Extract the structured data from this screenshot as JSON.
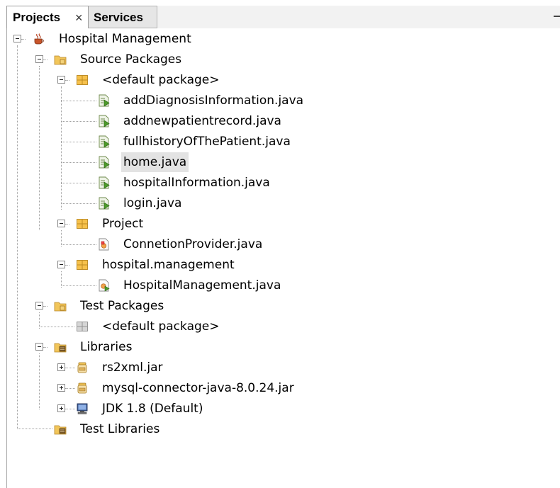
{
  "tabs": {
    "projects_label": "Projects",
    "close_glyph": "×",
    "services_label": "Services"
  },
  "tree": {
    "project_name": "Hospital Management",
    "source_packages": "Source Packages",
    "default_package": "<default package>",
    "files_default": [
      "addDiagnosisInformation.java",
      "addnewpatientrecord.java",
      "fullhistoryOfThePatient.java",
      "home.java",
      "hospitalInformation.java",
      "login.java"
    ],
    "selected_file": "home.java",
    "project_package": "Project",
    "project_package_file": "ConnetionProvider.java",
    "hospital_package": "hospital.management",
    "hospital_package_file": "HospitalManagement.java",
    "test_packages": "Test Packages",
    "test_default_package": "<default package>",
    "libraries": "Libraries",
    "library_items": [
      "rs2xml.jar",
      "mysql-connector-java-8.0.24.jar",
      "JDK 1.8 (Default)"
    ],
    "test_libraries": "Test Libraries"
  },
  "icons": {
    "project": "coffee-cup-icon",
    "source_folder": "source-folder-icon",
    "package": "package-icon",
    "java_file": "java-file-icon",
    "java_class": "java-class-icon",
    "main_class": "main-class-icon",
    "empty_package": "empty-package-icon",
    "libraries_folder": "libraries-folder-icon",
    "jar": "jar-icon",
    "jdk": "jdk-icon"
  },
  "colors": {
    "selection": "#e3e3e3",
    "folder": "#e8b84a",
    "package": "#f0b43c",
    "java_file": "#5aa02c"
  }
}
